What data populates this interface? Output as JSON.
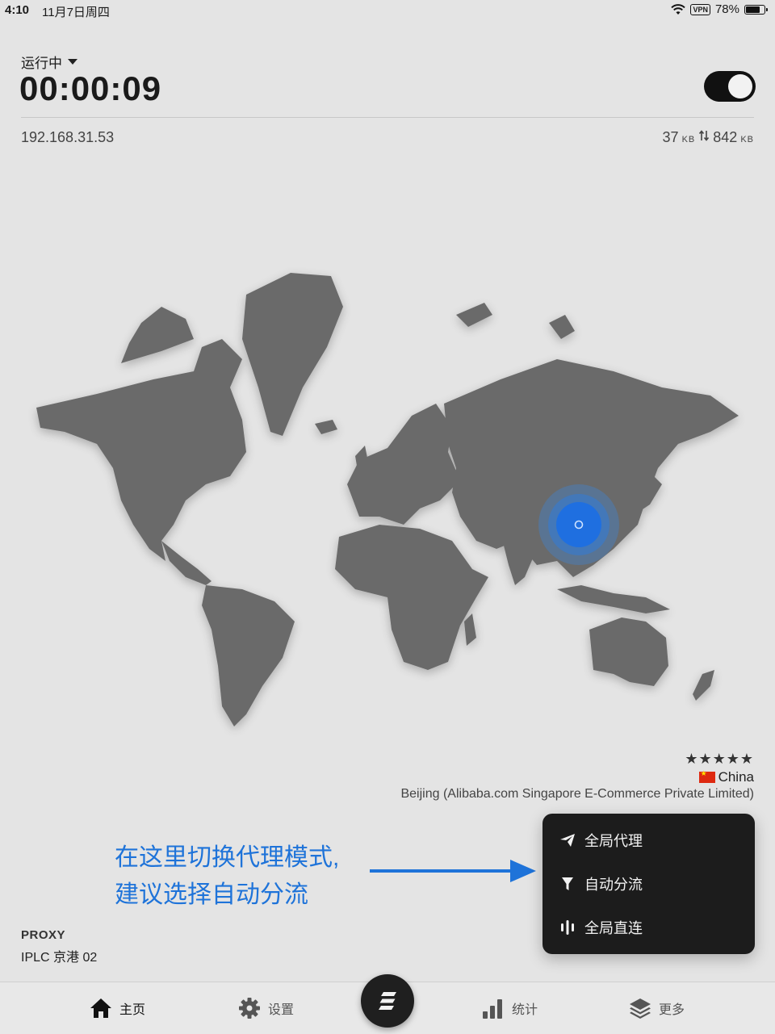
{
  "status_bar": {
    "time": "4:10",
    "date": "11月7日周四",
    "vpn": "VPN",
    "battery": "78%",
    "battery_level": 0.78
  },
  "header": {
    "run_status": "运行中",
    "timer": "00:00:09",
    "toggle_on": true
  },
  "network": {
    "ip": "192.168.31.53",
    "upload_value": "37",
    "upload_unit": "KB",
    "download_value": "842",
    "download_unit": "KB"
  },
  "location": {
    "rating": "★★★★★",
    "country": "China",
    "provider": "Beijing (Alibaba.com Singapore E-Commerce Private Limited)"
  },
  "annotation": {
    "line1": "在这里切换代理模式,",
    "line2": "建议选择自动分流"
  },
  "mode_menu": {
    "items": [
      {
        "label": "全局代理",
        "icon": "paper-plane-icon"
      },
      {
        "label": "自动分流",
        "icon": "filter-icon"
      },
      {
        "label": "全局直连",
        "icon": "bars-icon"
      }
    ]
  },
  "proxy": {
    "label": "PROXY",
    "node": "IPLC 京港 02"
  },
  "tab_bar": {
    "tabs": [
      {
        "label": "主页",
        "icon": "home-icon",
        "active": true
      },
      {
        "label": "设置",
        "icon": "gear-icon",
        "active": false
      },
      {
        "label": "统计",
        "icon": "chart-icon",
        "active": false
      },
      {
        "label": "更多",
        "icon": "layers-icon",
        "active": false
      }
    ],
    "center_icon": "logo-icon"
  },
  "colors": {
    "background": "#e4e4e4",
    "map_land": "#6b6b6b",
    "accent_blue": "#1e73d9",
    "menu_bg": "#1c1c1c"
  }
}
